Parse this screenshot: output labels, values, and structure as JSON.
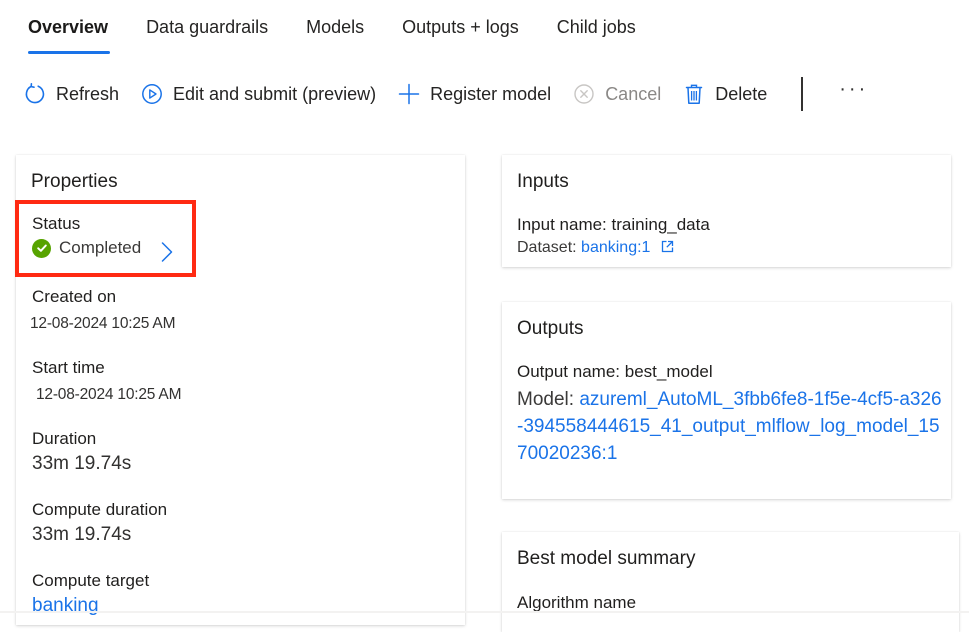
{
  "tabs": [
    {
      "label": "Overview",
      "active": true
    },
    {
      "label": "Data guardrails",
      "active": false
    },
    {
      "label": "Models",
      "active": false
    },
    {
      "label": "Outputs + logs",
      "active": false
    },
    {
      "label": "Child jobs",
      "active": false
    }
  ],
  "toolbar": {
    "refresh": {
      "label": "Refresh",
      "icon": "refresh-icon"
    },
    "edit_submit": {
      "label": "Edit and submit (preview)",
      "icon": "play-circle-icon"
    },
    "register_model": {
      "label": "Register model",
      "icon": "plus-icon"
    },
    "cancel": {
      "label": "Cancel",
      "icon": "cancel-circle-icon",
      "disabled": true
    },
    "delete": {
      "label": "Delete",
      "icon": "trash-icon"
    },
    "more": {
      "label": "···",
      "icon": "more-icon"
    }
  },
  "properties": {
    "title": "Properties",
    "status": {
      "label": "Status",
      "value": "Completed",
      "color": "#57a300"
    },
    "created_on": {
      "label": "Created on",
      "value": "12-08-2024 10:25 AM"
    },
    "start_time": {
      "label": "Start time",
      "value": "12-08-2024 10:25 AM"
    },
    "duration": {
      "label": "Duration",
      "value": "33m 19.74s"
    },
    "compute_duration": {
      "label": "Compute duration",
      "value": "33m 19.74s"
    },
    "compute_target": {
      "label": "Compute target",
      "value": "banking"
    }
  },
  "inputs": {
    "title": "Inputs",
    "input_name_label": "Input name:",
    "input_name": "training_data",
    "dataset_label": "Dataset:",
    "dataset_link": "banking:1"
  },
  "outputs": {
    "title": "Outputs",
    "output_name_label": "Output name:",
    "output_name": "best_model",
    "model_label": "Model:",
    "model_link": "azureml_AutoML_3fbb6fe8-1f5e-4cf5-a326-394558444615_41_output_mlflow_log_model_1570020236:1"
  },
  "best_model_summary": {
    "title": "Best model summary",
    "algorithm_name_label": "Algorithm name"
  },
  "colors": {
    "accent": "#1a73e8",
    "highlight_border": "#ff2a12",
    "success": "#57a300"
  }
}
